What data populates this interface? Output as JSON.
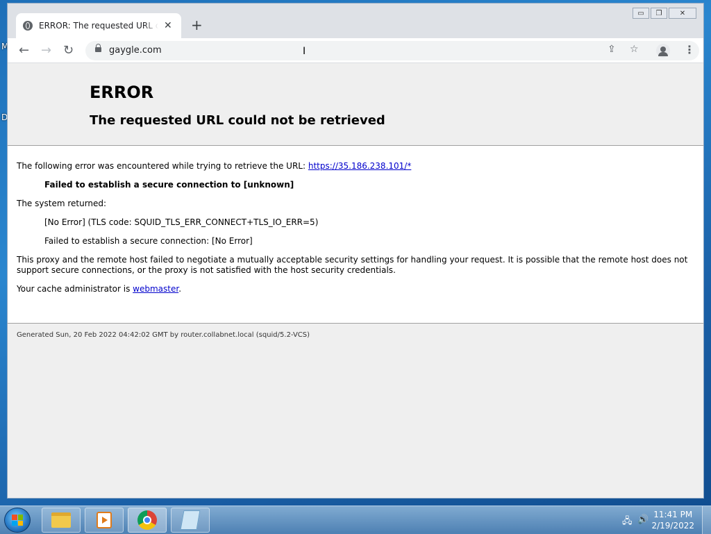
{
  "desktop": {
    "letters": [
      "M",
      "D"
    ]
  },
  "browser": {
    "tab_title": "ERROR: The requested URL could not be retrieved",
    "new_tab_symbol": "+",
    "close_tab_symbol": "✕",
    "url": "gaygle.com",
    "window_controls": {
      "minimize": "▭",
      "maximize": "❐",
      "close": "✕"
    }
  },
  "page": {
    "heading": "ERROR",
    "subheading": "The requested URL could not be retrieved",
    "intro_text": "The following error was encountered while trying to retrieve the URL: ",
    "intro_link": "https://35.186.238.101/*",
    "error_detail": "Failed to establish a secure connection to [unknown]",
    "system_returned_label": "The system returned:",
    "system_code": "[No Error] (TLS code: SQUID_TLS_ERR_CONNECT+TLS_IO_ERR=5)",
    "system_message": "Failed to establish a secure connection: [No Error]",
    "explanation": "This proxy and the remote host failed to negotiate a mutually acceptable security settings for handling your request. It is possible that the remote host does not support secure connections, or the proxy is not satisfied with the host security credentials.",
    "admin_text": "Your cache administrator is ",
    "admin_link": "webmaster",
    "admin_suffix": ".",
    "footer": "Generated Sun, 20 Feb 2022 04:42:02 GMT by router.collabnet.local (squid/5.2-VCS)"
  },
  "taskbar": {
    "time": "11:41 PM",
    "date": "2/19/2022",
    "items": [
      "file-explorer",
      "media-player",
      "google-chrome",
      "notepad"
    ],
    "colors": {
      "start_flag": [
        "#f25022",
        "#7fba00",
        "#00a4ef",
        "#ffb900"
      ]
    }
  }
}
